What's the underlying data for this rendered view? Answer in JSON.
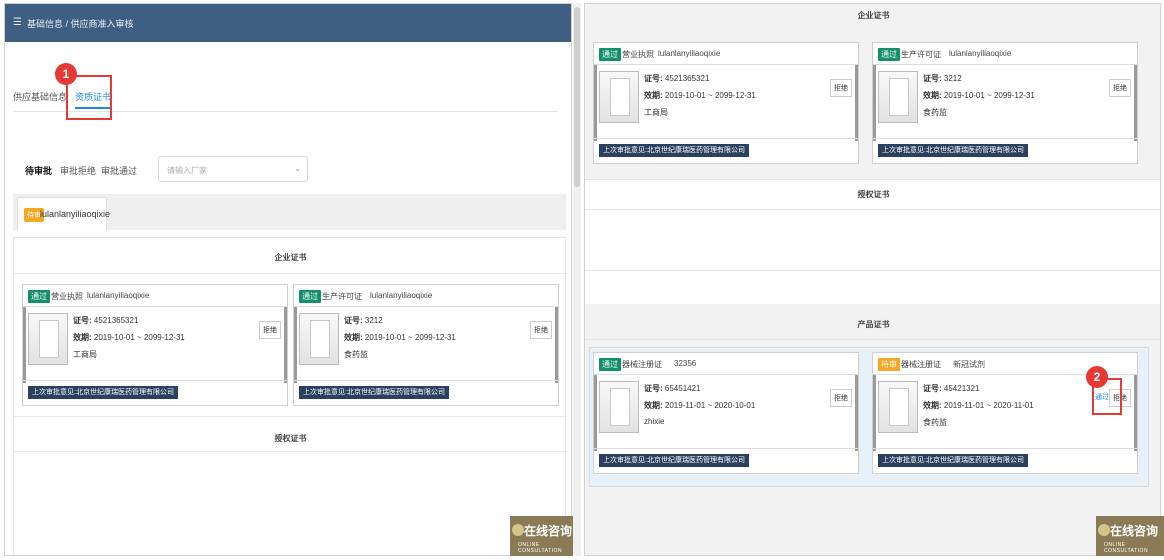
{
  "left": {
    "breadcrumb_menu_icon": "menu-icon",
    "breadcrumb": "基础信息 / 供应商准入审核",
    "tabs": [
      {
        "label": "供应基础信息"
      },
      {
        "label": "资质证书"
      }
    ],
    "callout_1": "1",
    "sub_tabs": [
      {
        "label": "待审批"
      },
      {
        "label": "审批拒绝"
      },
      {
        "label": "审批通过"
      }
    ],
    "select_placeholder": "请输入厂家",
    "supplier": {
      "tag": "待审",
      "name": "lulanlanyiliaoqixie"
    },
    "section_enterprise": "企业证书",
    "section_auth": "授权证书",
    "cards": [
      {
        "status": "通过",
        "type": "营业执照",
        "name": "lulanlanyiliaoqixie",
        "cert_label": "证号:",
        "cert_no": "4521365321",
        "period_label": "效期:",
        "period": "2019-10-01 ~ 2099-12-31",
        "issuer": "工商局",
        "reject": "拒绝",
        "owner": "上次审批意见:北京世纪康瑞医药管理有限公司"
      },
      {
        "status": "通过",
        "type": "生产许可证",
        "name": "lulanlanyiliaoqixie",
        "cert_label": "证号:",
        "cert_no": "3212",
        "period_label": "效期:",
        "period": "2019-10-01 ~ 2099-12-31",
        "issuer": "食药监",
        "reject": "拒绝",
        "owner": "上次审批意见:北京世纪康瑞医药管理有限公司"
      }
    ]
  },
  "right": {
    "section_enterprise": "企业证书",
    "section_auth": "授权证书",
    "section_product": "产品证书",
    "callout_2": "2",
    "enterprise_cards": [
      {
        "status": "通过",
        "type": "营业执照",
        "name": "lulanlanyiliaoqixie",
        "cert_label": "证号:",
        "cert_no": "4521365321",
        "period_label": "效期:",
        "period": "2019-10-01 ~ 2099-12-31",
        "issuer": "工商局",
        "reject": "拒绝",
        "owner": "上次审批意见:北京世纪康瑞医药管理有限公司"
      },
      {
        "status": "通过",
        "type": "生产许可证",
        "name": "lulanlanyiliaoqixie",
        "cert_label": "证号:",
        "cert_no": "3212",
        "period_label": "效期:",
        "period": "2019-10-01 ~ 2099-12-31",
        "issuer": "食药监",
        "reject": "拒绝",
        "owner": "上次审批意见:北京世纪康瑞医药管理有限公司"
      }
    ],
    "product_cards": [
      {
        "status": "通过",
        "type": "器械注册证",
        "name": "32356",
        "cert_label": "证号:",
        "cert_no": "65451421",
        "period_label": "效期:",
        "period": "2019-11-01 ~ 2020-10-01",
        "issuer": "zhixie",
        "reject": "拒绝",
        "owner": "上次审批意见:北京世纪康瑞医药管理有限公司"
      },
      {
        "status": "待审",
        "type": "器械注册证",
        "name": "新冠试剂",
        "cert_label": "证号:",
        "cert_no": "45421321",
        "period_label": "效期:",
        "period": "2019-11-01 ~ 2020-11-01",
        "issuer": "食药监",
        "pass": "通过",
        "reject": "拒绝",
        "owner": "上次审批意见:北京世纪康瑞医药管理有限公司"
      }
    ]
  },
  "consult": {
    "title": "在线咨询",
    "subtitle": "ONLINE CONSULTATION"
  },
  "colors": {
    "topbar": "#3e5f82",
    "pass_green": "#138f6b",
    "pending_orange": "#f5a623",
    "owner_bg": "#2b3f5e",
    "highlight_red": "#e53935",
    "active_blue": "#1e88e5"
  }
}
